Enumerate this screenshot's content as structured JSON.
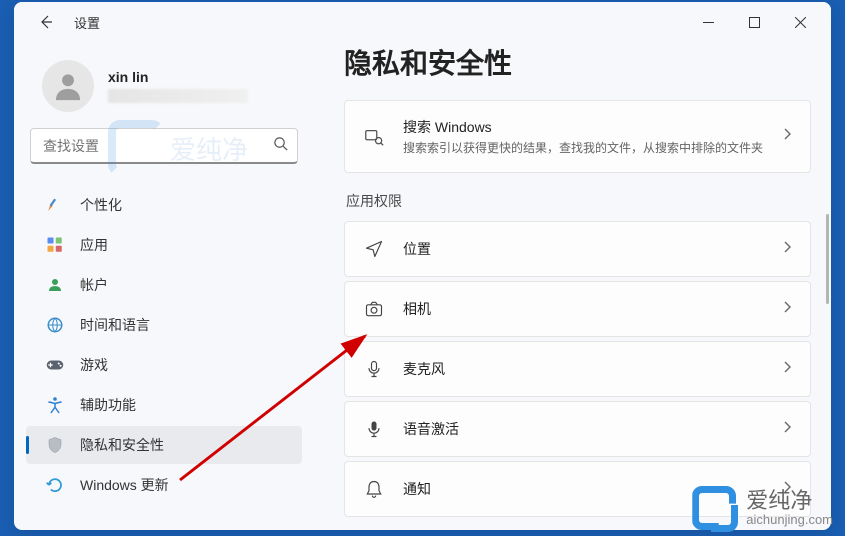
{
  "titlebar": {
    "app_name": "设置"
  },
  "user": {
    "name": "xin lin"
  },
  "search": {
    "placeholder": "查找设置"
  },
  "sidebar": {
    "items": [
      {
        "label": "个性化",
        "icon": "personalization-icon"
      },
      {
        "label": "应用",
        "icon": "apps-icon"
      },
      {
        "label": "帐户",
        "icon": "accounts-icon"
      },
      {
        "label": "时间和语言",
        "icon": "time-language-icon"
      },
      {
        "label": "游戏",
        "icon": "gaming-icon"
      },
      {
        "label": "辅助功能",
        "icon": "accessibility-icon"
      },
      {
        "label": "隐私和安全性",
        "icon": "privacy-icon"
      },
      {
        "label": "Windows 更新",
        "icon": "update-icon"
      }
    ],
    "active_index": 6
  },
  "main": {
    "title": "隐私和安全性",
    "search_windows": {
      "title": "搜索 Windows",
      "subtitle": "搜索索引以获得更快的结果，查找我的文件，从搜索中排除的文件夹"
    },
    "section_label": "应用权限",
    "rows": [
      {
        "label": "位置",
        "icon": "location-icon"
      },
      {
        "label": "相机",
        "icon": "camera-icon"
      },
      {
        "label": "麦克风",
        "icon": "microphone-icon"
      },
      {
        "label": "语音激活",
        "icon": "voice-activation-icon"
      },
      {
        "label": "通知",
        "icon": "notifications-icon"
      }
    ]
  },
  "watermark": {
    "text": "爱纯净",
    "domain": "aichunjing.com"
  }
}
